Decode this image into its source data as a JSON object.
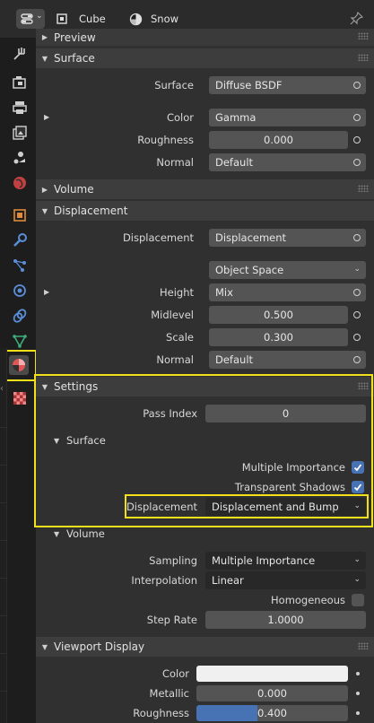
{
  "header": {
    "object_name": "Cube",
    "material_name": "Snow"
  },
  "tabs": [
    {
      "icon": "tool-icon"
    },
    {
      "icon": "render-icon"
    },
    {
      "icon": "output-icon"
    },
    {
      "icon": "view-layer-icon"
    },
    {
      "icon": "scene-icon"
    },
    {
      "icon": "world-icon"
    },
    {
      "icon": "object-icon"
    },
    {
      "icon": "modifier-icon"
    },
    {
      "icon": "particles-icon"
    },
    {
      "icon": "physics-icon"
    },
    {
      "icon": "constraints-icon"
    },
    {
      "icon": "object-data-icon"
    },
    {
      "icon": "material-icon",
      "active": true
    },
    {
      "icon": "texture-icon"
    }
  ],
  "panels": {
    "preview": "Preview",
    "surface": "Surface",
    "volume": "Volume",
    "displacement": "Displacement",
    "settings": "Settings",
    "viewport_display": "Viewport Display"
  },
  "surface": {
    "surface_label": "Surface",
    "surface_value": "Diffuse BSDF",
    "color_label": "Color",
    "color_value": "Gamma",
    "roughness_label": "Roughness",
    "roughness_value": "0.000",
    "normal_label": "Normal",
    "normal_value": "Default"
  },
  "displacement": {
    "disp_label": "Displacement",
    "disp_value": "Displacement",
    "space_value": "Object Space",
    "height_label": "Height",
    "height_value": "Mix",
    "midlevel_label": "Midlevel",
    "midlevel_value": "0.500",
    "scale_label": "Scale",
    "scale_value": "0.300",
    "normal_label": "Normal",
    "normal_value": "Default"
  },
  "settings": {
    "pass_index_label": "Pass Index",
    "pass_index_value": "0",
    "surface_sub": "Surface",
    "multiple_importance_label": "Multiple Importance",
    "multiple_importance": true,
    "transparent_shadows_label": "Transparent Shadows",
    "transparent_shadows": true,
    "displacement_label": "Displacement",
    "displacement_value": "Displacement and Bump",
    "volume_sub": "Volume",
    "sampling_label": "Sampling",
    "sampling_value": "Multiple Importance",
    "interpolation_label": "Interpolation",
    "interpolation_value": "Linear",
    "homogeneous_label": "Homogeneous",
    "homogeneous": false,
    "step_rate_label": "Step Rate",
    "step_rate_value": "1.0000"
  },
  "viewport_display": {
    "color_label": "Color",
    "color_value": "#f0f0f0",
    "metallic_label": "Metallic",
    "metallic_value": "0.000",
    "roughness_label": "Roughness",
    "roughness_value": "0.400",
    "roughness_fill": 0.4
  },
  "colors": {
    "accent": "#4772b3",
    "highlight": "#f2e01a"
  }
}
